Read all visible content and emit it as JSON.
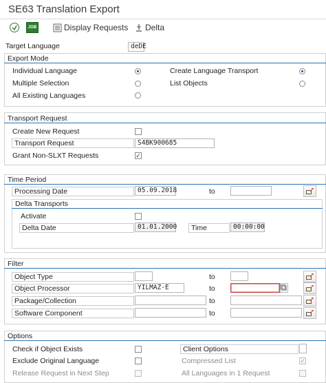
{
  "window": {
    "title": "SE63 Translation Export"
  },
  "toolbar": {
    "execute_icon": "execute-icon",
    "job_label": "JOB",
    "display_requests": "Display Requests",
    "delta": "Delta"
  },
  "target_language": {
    "label": "Target Language",
    "value": "deDE"
  },
  "export_mode": {
    "title": "Export Mode",
    "individual_language": "Individual Language",
    "multiple_selection": "Multiple Selection",
    "all_existing_languages": "All Existing Languages",
    "create_language_transport": "Create Language Transport",
    "list_objects": "List Objects"
  },
  "transport_request": {
    "title": "Transport Request",
    "create_new_request": "Create New Request",
    "transport_request_label": "Transport Request",
    "transport_request_value": "S4BK900685",
    "grant_non_slxt": "Grant Non-SLXT Requests",
    "grant_checked": "✓"
  },
  "time_period": {
    "title": "Time Period",
    "processing_date_label": "Processing Date",
    "processing_date_value": "05.09.2018",
    "to": "to",
    "delta_transports_title": "Delta Transports",
    "activate": "Activate",
    "delta_date_label": "Delta Date",
    "delta_date_value": "01.01.2000",
    "time_label": "Time",
    "time_value": "00:00:00"
  },
  "filter": {
    "title": "Filter",
    "object_type": "Object Type",
    "object_processor": "Object Processor",
    "object_processor_value": "YILMAZ-E",
    "package_collection": "Package/Collection",
    "software_component": "Software Component",
    "to": "to"
  },
  "options": {
    "title": "Options",
    "check_if_object_exists": "Check if Object Exists",
    "exclude_original_language": "Exclude Original Language",
    "release_request": "Release Request in Next Step",
    "client_options": "Client Options",
    "compressed_list": "Compressed List",
    "compressed_checked": "✓",
    "all_languages_in_1_request": "All Languages in 1 Request"
  }
}
